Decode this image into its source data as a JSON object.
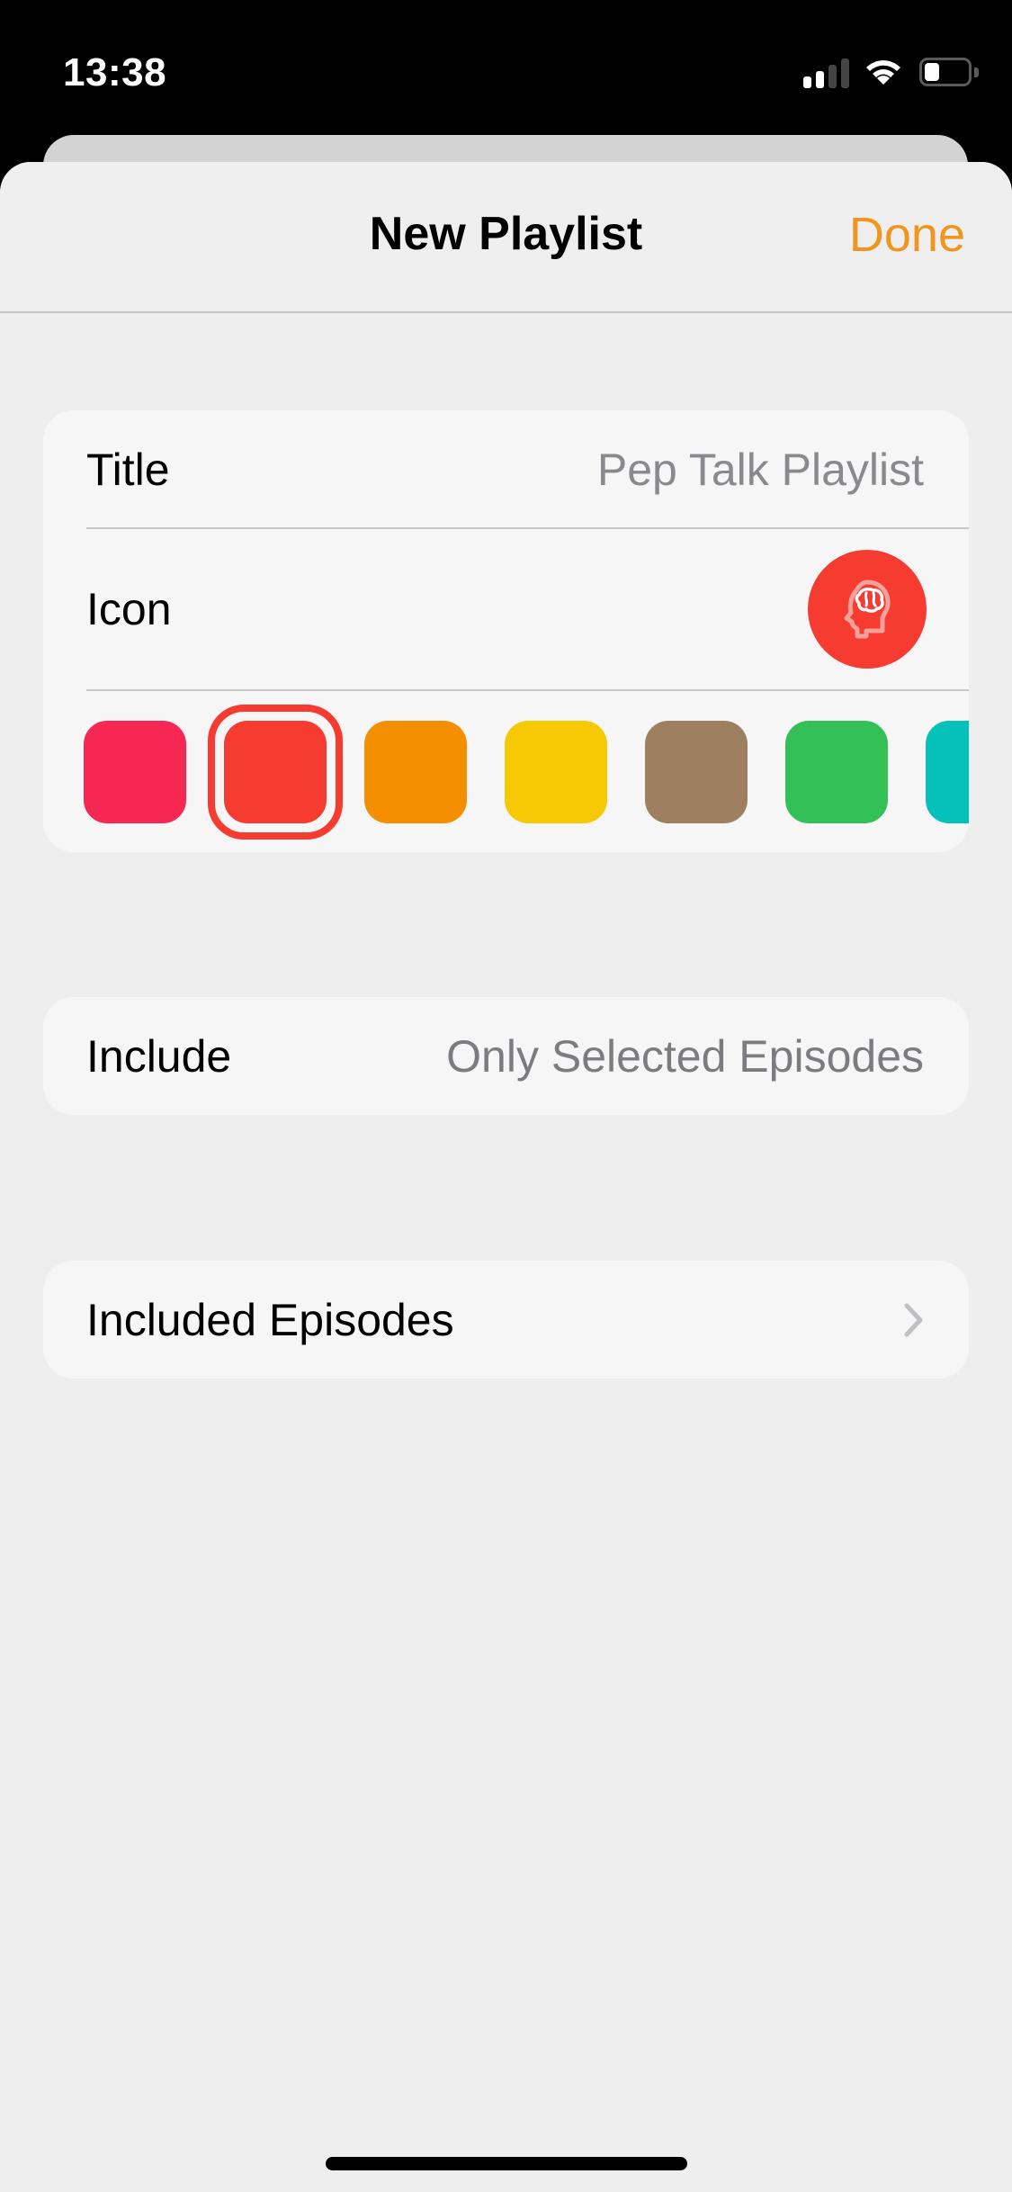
{
  "status_bar": {
    "time": "13:38",
    "signal_bars_active": 2,
    "signal_bars_total": 4,
    "wifi_icon": "wifi-icon",
    "battery_level_percent": 35
  },
  "nav": {
    "title": "New Playlist",
    "done_label": "Done",
    "accent_color": "#F0961F"
  },
  "details": {
    "title_label": "Title",
    "title_placeholder": "Pep Talk Playlist",
    "icon_label": "Icon",
    "selected_icon": "head-brain-icon",
    "selected_color": "#F63B31",
    "colors": [
      {
        "name": "pink",
        "hex": "#F72754",
        "selected": false
      },
      {
        "name": "red",
        "hex": "#F63B31",
        "selected": true
      },
      {
        "name": "orange",
        "hex": "#F58F02",
        "selected": false
      },
      {
        "name": "yellow",
        "hex": "#F6C806",
        "selected": false
      },
      {
        "name": "brown",
        "hex": "#9E8060",
        "selected": false
      },
      {
        "name": "green",
        "hex": "#33C057",
        "selected": false
      },
      {
        "name": "teal",
        "hex": "#06C0BA",
        "selected": false
      }
    ]
  },
  "include": {
    "label": "Include",
    "value": "Only Selected Episodes"
  },
  "included_episodes": {
    "label": "Included Episodes",
    "chevron_icon": "chevron-right-icon"
  }
}
